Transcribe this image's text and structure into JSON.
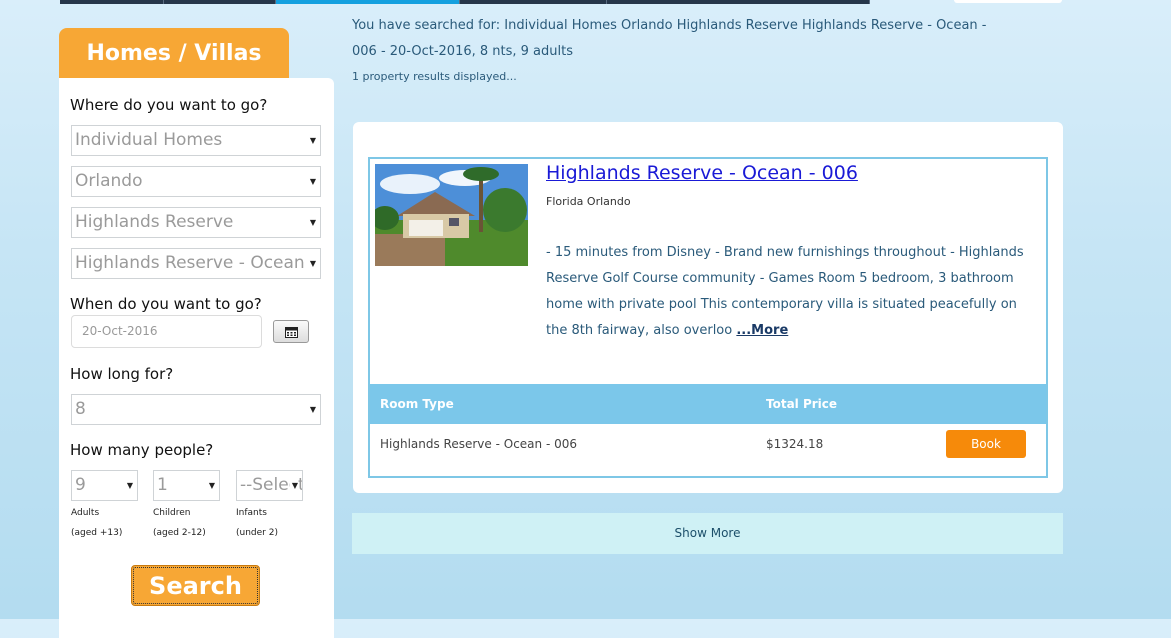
{
  "sidebar": {
    "tab_title": "Homes / Villas",
    "where_label": "Where do you want to go?",
    "selects": {
      "type": "Individual Homes",
      "region": "Orlando",
      "resort": "Highlands Reserve",
      "property": "Highlands Reserve - Ocean - 006"
    },
    "when_label": "When do you want to go?",
    "date_value": "20-Oct-2016",
    "how_long_label": "How long for?",
    "nights": "8",
    "how_many_label": "How many people?",
    "adults": "9",
    "children": "1",
    "infants": "--Select--",
    "adults_label": "Adults",
    "adults_age": "(aged +13)",
    "children_label": "Children",
    "children_age": "(aged 2-12)",
    "infants_label": "Infants",
    "infants_age": "(under 2)",
    "search_label": "Search"
  },
  "main": {
    "summary": "You have searched for: Individual Homes Orlando Highlands Reserve Highlands Reserve - Ocean - 006 - 20-Oct-2016, 8 nts, 9 adults",
    "count": "1 property results displayed...",
    "property": {
      "title": "Highlands Reserve - Ocean - 006",
      "location": "Florida Orlando",
      "description": "- 15 minutes from Disney - Brand new furnishings throughout - Highlands Reserve Golf Course community - Games Room 5 bedroom, 3 bathroom home with private pool This contemporary villa is situated peacefully on the 8th fairway, also overloo",
      "more_label": "...More"
    },
    "table": {
      "headers": [
        "Room Type",
        "Total Price"
      ],
      "row": {
        "room_type": "Highlands Reserve - Ocean - 006",
        "price": "$1324.18",
        "book_label": "Book"
      }
    },
    "show_more_label": "Show More"
  },
  "colors": {
    "accent": "#f7a735",
    "book": "#f68a0a",
    "table_header": "#7bc7ea",
    "link": "#1a1ad6"
  },
  "icons": {
    "calendar": "calendar-icon",
    "dropdown": "chevron-down-icon"
  }
}
